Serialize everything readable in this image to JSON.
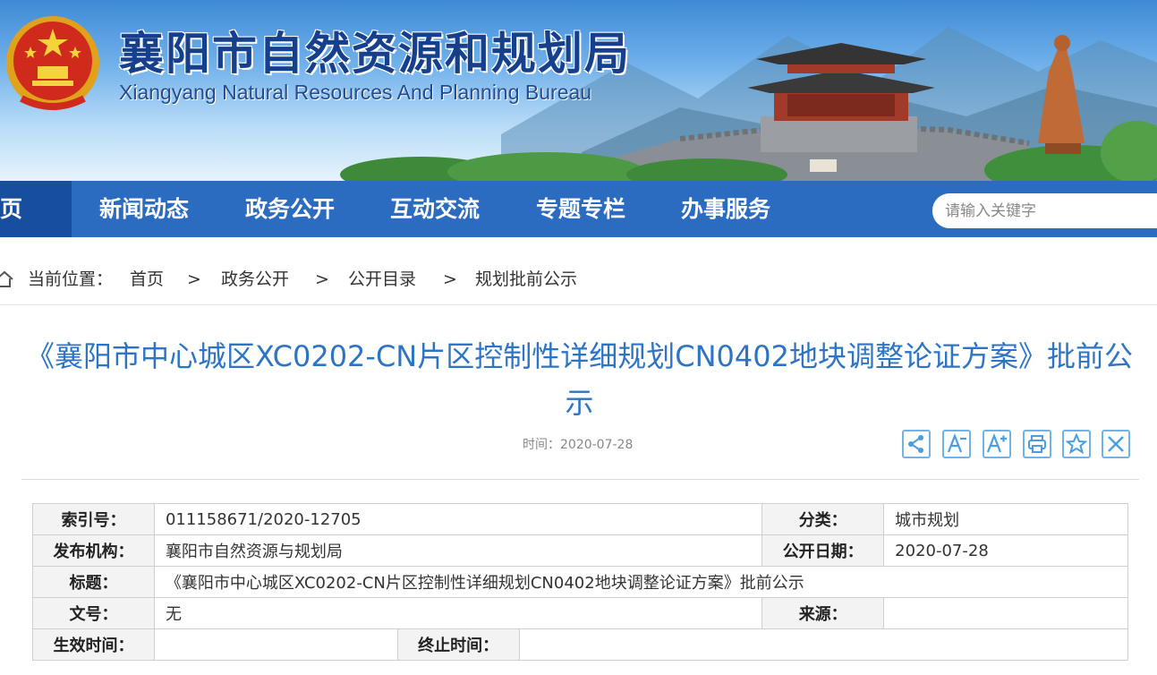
{
  "site": {
    "title": "襄阳市自然资源和规划局",
    "subtitle": "Xiangyang Natural Resources And Planning Bureau",
    "emblem_icon": "national-emblem-icon"
  },
  "nav": {
    "items": [
      {
        "label": "页",
        "active": true
      },
      {
        "label": "新闻动态"
      },
      {
        "label": "政务公开"
      },
      {
        "label": "互动交流"
      },
      {
        "label": "专题专栏"
      },
      {
        "label": "办事服务"
      }
    ],
    "search_placeholder": "请输入关键字"
  },
  "breadcrumb": {
    "prefix": "当前位置：",
    "items": [
      "首页",
      "政务公开",
      "公开目录",
      "规划批前公示"
    ],
    "separator": ">"
  },
  "article": {
    "title": "《襄阳市中心城区XC0202-CN片区控制性详细规划CN0402地块调整论证方案》批前公示",
    "date": "时间：2020-07-28"
  },
  "toolbar": {
    "icons": [
      "share-icon",
      "font-decrease-icon",
      "font-increase-icon",
      "print-icon",
      "favorite-icon",
      "close-icon"
    ]
  },
  "meta": {
    "index_label": "索引号：",
    "index_value": "011158671/2020-12705",
    "category_label": "分类：",
    "category_value": "城市规划",
    "publisher_label": "发布机构：",
    "publisher_value": "襄阳市自然资源与规划局",
    "pubdate_label": "公开日期：",
    "pubdate_value": "2020-07-28",
    "title_label": "标题：",
    "title_value": "《襄阳市中心城区XC0202-CN片区控制性详细规划CN0402地块调整论证方案》批前公示",
    "docno_label": "文号：",
    "docno_value": "无",
    "source_label": "来源：",
    "source_value": "",
    "effective_label": "生效时间：",
    "effective_value": "",
    "expiry_label": "终止时间：",
    "expiry_value": ""
  },
  "colors": {
    "nav_bg": "#2b6cc0",
    "nav_active": "#174f9e",
    "title_blue": "#2d74c6",
    "toolbar_border": "#6fb3ea"
  }
}
